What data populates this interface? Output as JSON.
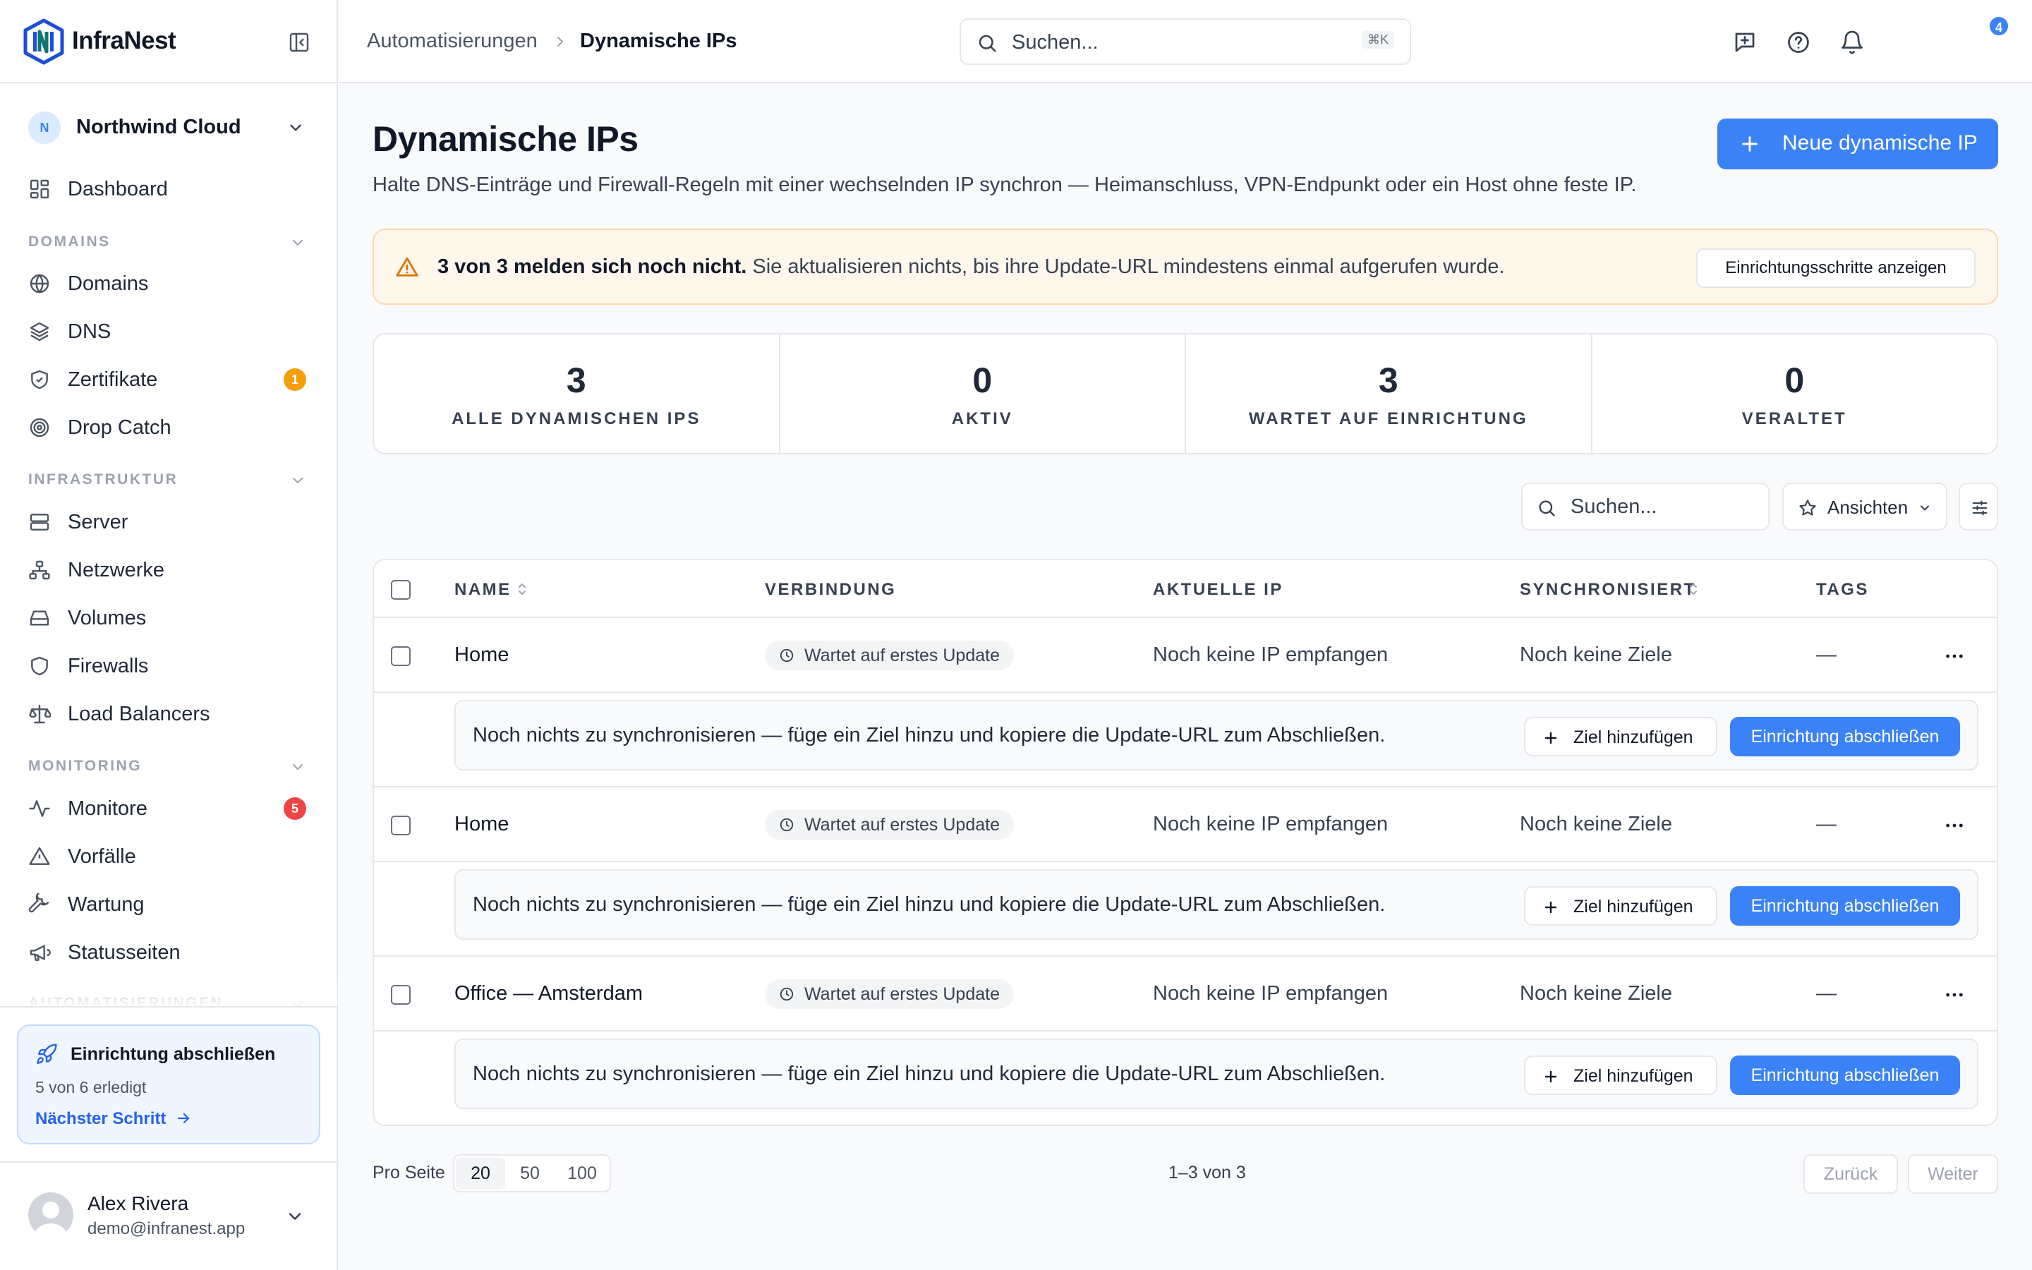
{
  "brand": {
    "name": "InfraNest"
  },
  "org": {
    "initial": "N",
    "name": "Northwind Cloud"
  },
  "nav": {
    "dashboard": "Dashboard",
    "sections": {
      "domains": "DOMAINS",
      "infra": "INFRASTRUKTUR",
      "monitoring": "MONITORING",
      "automation": "AUTOMATISIERUNGEN"
    },
    "items": {
      "domains": "Domains",
      "dns": "DNS",
      "certs": "Zertifikate",
      "certs_badge": "1",
      "dropcatch": "Drop Catch",
      "server": "Server",
      "networks": "Netzwerke",
      "volumes": "Volumes",
      "firewalls": "Firewalls",
      "lbs": "Load Balancers",
      "monitors": "Monitore",
      "monitors_badge": "5",
      "incidents": "Vorfälle",
      "maintenance": "Wartung",
      "statuspages": "Statusseiten"
    }
  },
  "setup": {
    "title": "Einrichtung abschließen",
    "progress": "5 von 6 erledigt",
    "next": "Nächster Schritt"
  },
  "user": {
    "name": "Alex Rivera",
    "email": "demo@infranest.app"
  },
  "topbar": {
    "breadcrumb": [
      "Automatisierungen",
      "Dynamische IPs"
    ],
    "search_placeholder": "Suchen...",
    "search_shortcut": "⌘K",
    "notifications": "4"
  },
  "page": {
    "title": "Dynamische IPs",
    "subtitle": "Halte DNS-Einträge und Firewall-Regeln mit einer wechselnden IP synchron — Heimanschluss, VPN-Endpunkt oder ein Host ohne feste IP.",
    "new_button": "Neue dynamische IP"
  },
  "alert": {
    "bold": "3 von 3 melden sich noch nicht.",
    "text": "Sie aktualisieren nichts, bis ihre Update-URL mindestens einmal aufgerufen wurde.",
    "button": "Einrichtungsschritte anzeigen"
  },
  "stats": [
    {
      "value": "3",
      "label": "ALLE DYNAMISCHEN IPS"
    },
    {
      "value": "0",
      "label": "AKTIV"
    },
    {
      "value": "3",
      "label": "WARTET AUF EINRICHTUNG"
    },
    {
      "value": "0",
      "label": "VERALTET"
    }
  ],
  "toolbar": {
    "search_placeholder": "Suchen...",
    "views": "Ansichten"
  },
  "table": {
    "headers": {
      "name": "NAME",
      "connection": "VERBINDUNG",
      "ip": "AKTUELLE IP",
      "sync": "SYNCHRONISIERT",
      "tags": "TAGS"
    },
    "rows": [
      {
        "name": "Home",
        "status": "Wartet auf erstes Update",
        "ip": "Noch keine IP empfangen",
        "sync": "Noch keine Ziele",
        "tags": "—"
      },
      {
        "name": "Home",
        "status": "Wartet auf erstes Update",
        "ip": "Noch keine IP empfangen",
        "sync": "Noch keine Ziele",
        "tags": "—"
      },
      {
        "name": "Office — Amsterdam",
        "status": "Wartet auf erstes Update",
        "ip": "Noch keine IP empfangen",
        "sync": "Noch keine Ziele",
        "tags": "—"
      }
    ],
    "hint": "Noch nichts zu synchronisieren — füge ein Ziel hinzu und kopiere die Update-URL zum Abschließen.",
    "add_target": "Ziel hinzufügen",
    "finish": "Einrichtung abschließen"
  },
  "pagination": {
    "per_page_label": "Pro Seite",
    "options": [
      "20",
      "50",
      "100"
    ],
    "selected": "20",
    "info": "1–3 von 3",
    "prev": "Zurück",
    "next": "Weiter"
  },
  "colors": {
    "accent": "#3b82f6",
    "warning": "#d97706",
    "badge_orange": "#f59e0b",
    "badge_red": "#ef4444"
  }
}
